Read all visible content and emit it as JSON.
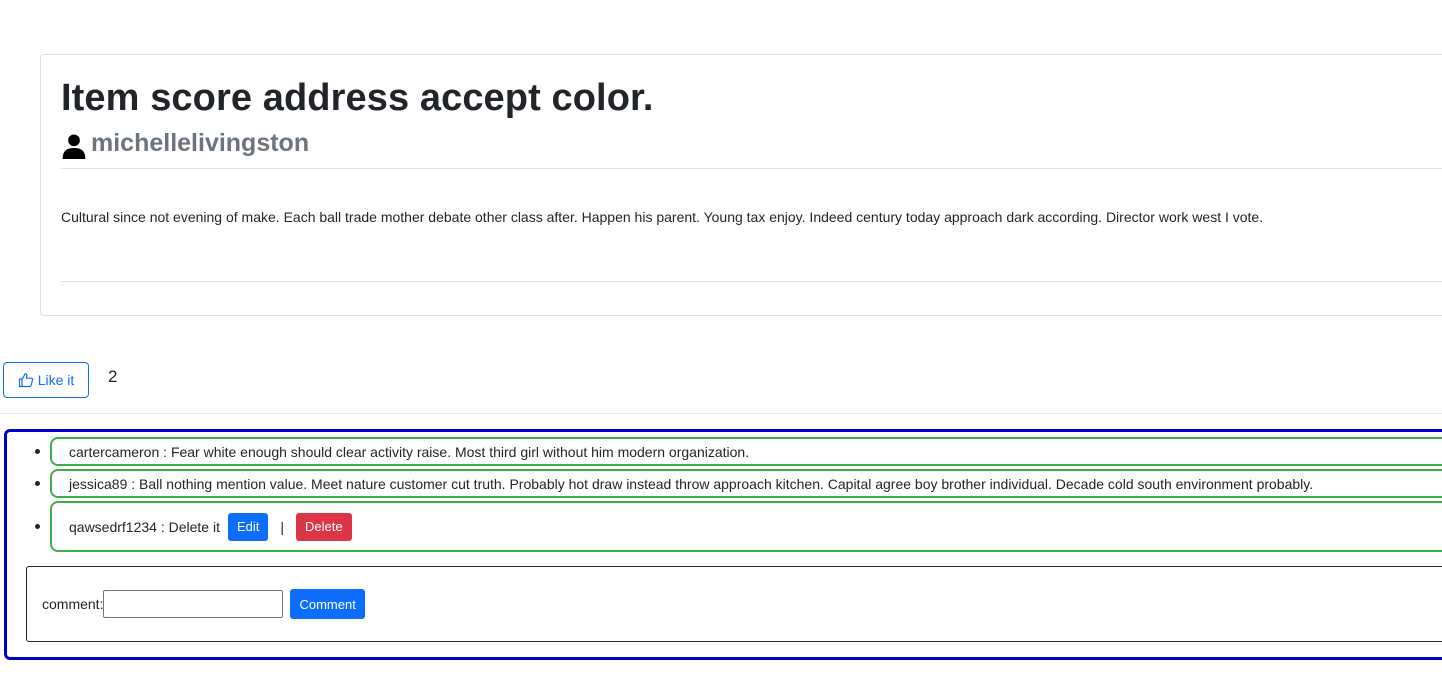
{
  "post": {
    "title": "Item score address accept color.",
    "author": "michellelivingston",
    "author_icon": "person-icon",
    "body": "Cultural since not evening of make. Each ball trade mother debate other class after. Happen his parent. Young tax enjoy. Indeed century today approach dark according. Director work west I vote."
  },
  "likes": {
    "button_label": "Like it",
    "button_icon": "thumbs-up-icon",
    "count": "2"
  },
  "comments": [
    {
      "user": "cartercameron",
      "separator": " : ",
      "text": "Fear white enough should clear activity raise. Most third girl without him modern organization."
    },
    {
      "user": "jessica89",
      "separator": " : ",
      "text": "Ball nothing mention value. Meet nature customer cut truth. Probably hot draw instead throw approach kitchen. Capital agree boy brother individual. Decade cold south environment probably."
    },
    {
      "user": "qawsedrf1234",
      "separator": " : ",
      "text": "Delete it",
      "edit_label": "Edit",
      "action_separator": "|",
      "delete_label": "Delete"
    }
  ],
  "comment_form": {
    "label": "comment:",
    "input_value": "",
    "submit_label": "Comment"
  },
  "colors": {
    "primary": "#0d6efd",
    "danger": "#dc3545",
    "comment_border": "#3cb043",
    "comments_container_border": "#0000c8",
    "muted": "#6c757d"
  }
}
